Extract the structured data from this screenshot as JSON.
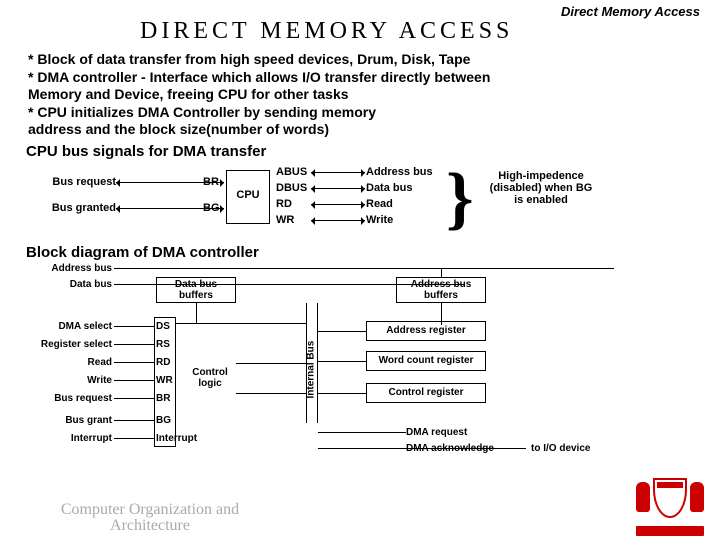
{
  "header": {
    "right_label": "Direct Memory Access"
  },
  "title": "DIRECT  MEMORY  ACCESS",
  "bullets": [
    "* Block of data transfer from high speed devices, Drum, Disk, Tape",
    "* DMA controller - Interface which allows I/O transfer directly between",
    "          Memory and Device, freeing CPU for other tasks",
    "* CPU initializes DMA Controller by sending memory",
    "          address and the block size(number of words)"
  ],
  "section1": "CPU bus signals for DMA transfer",
  "cpu": {
    "box_label": "CPU",
    "left": [
      {
        "label": "Bus request",
        "pin": "BR"
      },
      {
        "label": "Bus granted",
        "pin": "BG"
      }
    ],
    "right": [
      {
        "pin": "ABUS",
        "label": "Address bus"
      },
      {
        "pin": "DBUS",
        "label": "Data bus"
      },
      {
        "pin": "RD",
        "label": "Read"
      },
      {
        "pin": "WR",
        "label": "Write"
      }
    ],
    "hiz": "High-impedence (disabled) when BG is enabled"
  },
  "section2": "Block diagram of DMA controller",
  "block": {
    "top_labels": {
      "addr_bus": "Address bus",
      "data_bus": "Data bus"
    },
    "databus_buffers": "Data bus buffers",
    "addrbus_buffers": "Address bus buffers",
    "left_signals": [
      {
        "label": "DMA select",
        "pin": "DS"
      },
      {
        "label": "Register select",
        "pin": "RS"
      },
      {
        "label": "Read",
        "pin": "RD"
      },
      {
        "label": "Write",
        "pin": "WR"
      },
      {
        "label": "Bus request",
        "pin": "BR"
      },
      {
        "label": "Bus grant",
        "pin": "BG"
      },
      {
        "label": "Interrupt",
        "pin": "Interrupt"
      }
    ],
    "control_logic": "Control logic",
    "internal_bus": "Internal Bus",
    "right_regs": [
      "Address register",
      "Word count register",
      "Control register"
    ],
    "bottom": {
      "dma_req": "DMA request",
      "dma_ack": "DMA acknowledge",
      "to_io": "to I/O device"
    }
  },
  "footer": "Computer Organization and Architecture"
}
